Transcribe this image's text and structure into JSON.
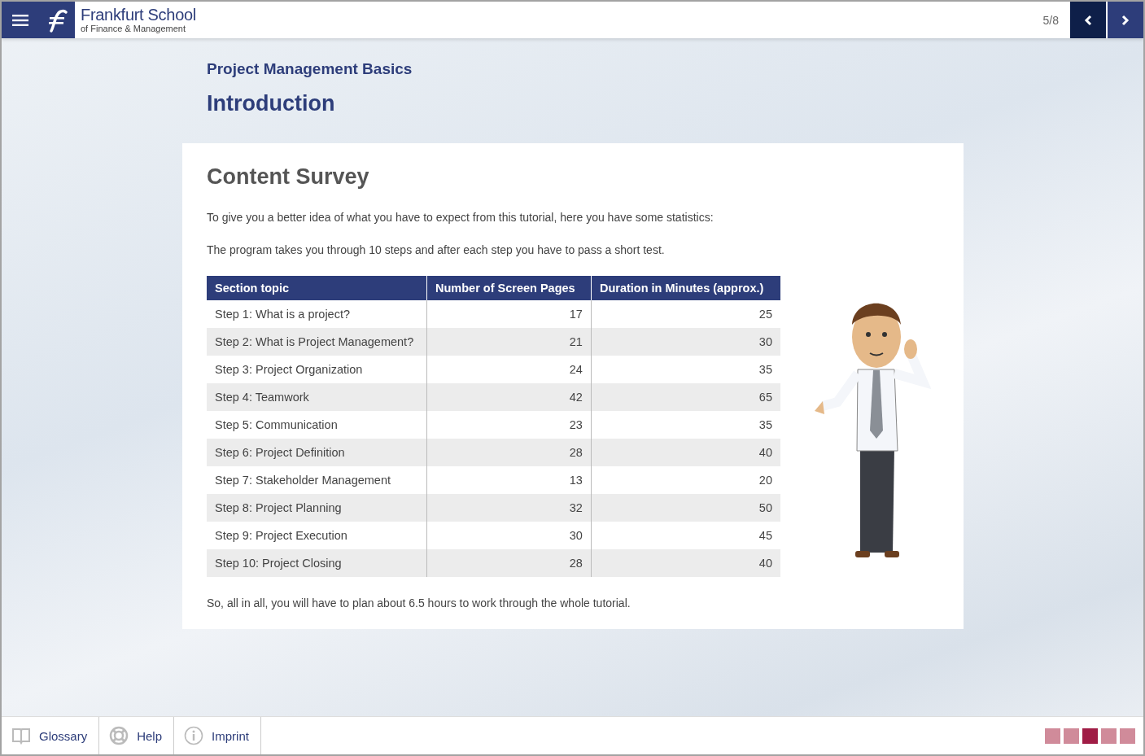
{
  "header": {
    "logo_title": "Frankfurt School",
    "logo_subtitle": "of Finance & Management",
    "page_counter": "5/8"
  },
  "course_title": "Project Management Basics",
  "chapter_title": "Introduction",
  "card": {
    "heading": "Content Survey",
    "paragraphs": [
      "To give you a better idea of what you have to expect from this tutorial, here you have some statistics:",
      "The program takes you through 10 steps and after each step you have to pass a short test."
    ],
    "table": {
      "columns": [
        "Section topic",
        "Number of Screen Pages",
        "Duration in Minutes (approx.)"
      ],
      "rows": [
        [
          "Step 1: What is a project?",
          "17",
          "25"
        ],
        [
          "Step 2: What is Project Management?",
          "21",
          "30"
        ],
        [
          "Step 3: Project Organization",
          "24",
          "35"
        ],
        [
          "Step 4: Teamwork",
          "42",
          "65"
        ],
        [
          "Step 5: Communication",
          "23",
          "35"
        ],
        [
          "Step 6: Project Definition",
          "28",
          "40"
        ],
        [
          "Step 7: Stakeholder Management",
          "13",
          "20"
        ],
        [
          "Step 8: Project Planning",
          "32",
          "50"
        ],
        [
          "Step 9: Project Execution",
          "30",
          "45"
        ],
        [
          "Step 10: Project Closing",
          "28",
          "40"
        ]
      ]
    },
    "summary": "So, all in all, you will have to plan about 6.5 hours to work through the whole tutorial."
  },
  "footer": {
    "links": [
      {
        "kind": "book",
        "label": "Glossary"
      },
      {
        "kind": "lifebuoy",
        "label": "Help"
      },
      {
        "kind": "info",
        "label": "Imprint"
      }
    ],
    "progress": [
      {
        "selected": false
      },
      {
        "selected": false
      },
      {
        "selected": true
      },
      {
        "selected": false
      },
      {
        "selected": false
      }
    ]
  }
}
